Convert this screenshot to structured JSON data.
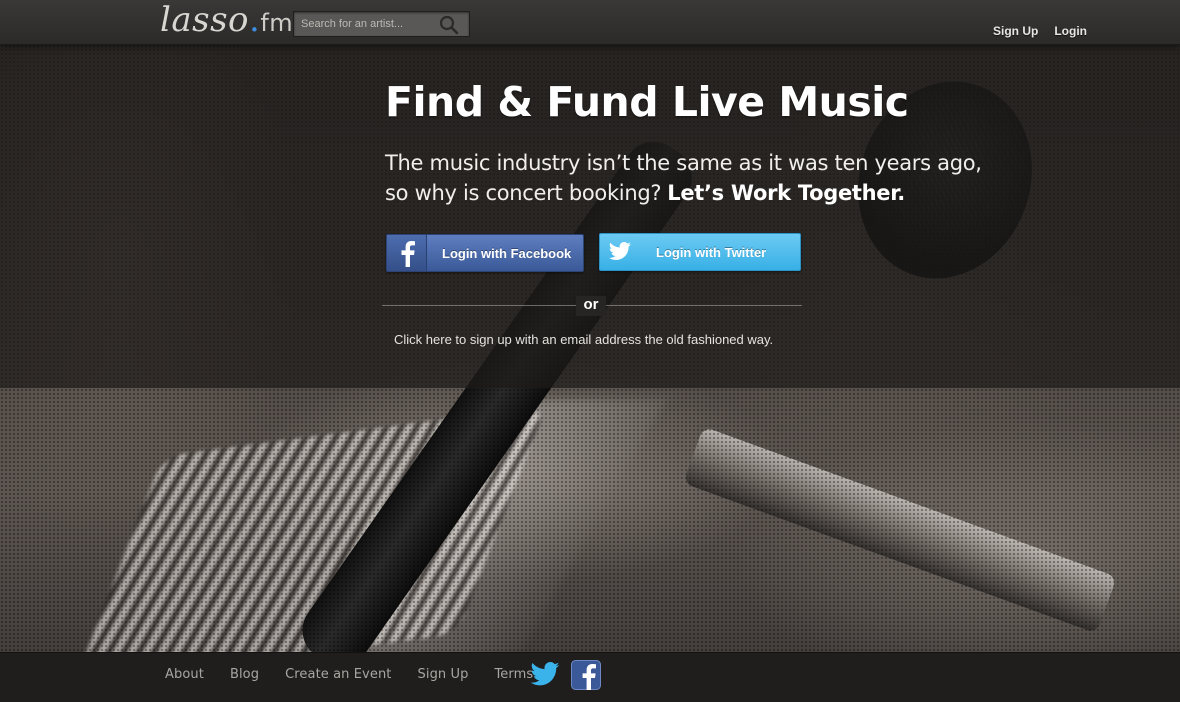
{
  "header": {
    "logo": {
      "name": "lasso",
      "dot": ".",
      "tld": "fm"
    },
    "search": {
      "placeholder": "Search for an artist..."
    },
    "nav": {
      "signup": "Sign Up",
      "login": "Login"
    }
  },
  "hero": {
    "title": "Find & Fund Live Music",
    "subtitle_line1": "The music industry isn’t the same as it was ten years ago,",
    "subtitle_line2": "so why is concert booking?",
    "subtitle_emphasis": "Let’s Work Together.",
    "facebook_button": "Login with Facebook",
    "twitter_button": "Login with Twitter",
    "divider_text": "or",
    "email_link": "Click here to sign up with an email address the old fashioned way."
  },
  "footer": {
    "links": {
      "about": "About",
      "blog": "Blog",
      "create_event": "Create an Event",
      "signup": "Sign Up",
      "terms": "Terms"
    },
    "social": [
      "twitter-icon",
      "facebook-icon"
    ]
  },
  "colors": {
    "logo_dot": "#3d8de0",
    "facebook": "#3b5998",
    "twitter": "#38b0e6",
    "topbar": "#2c2a29",
    "footer": "#1f1e1d"
  }
}
